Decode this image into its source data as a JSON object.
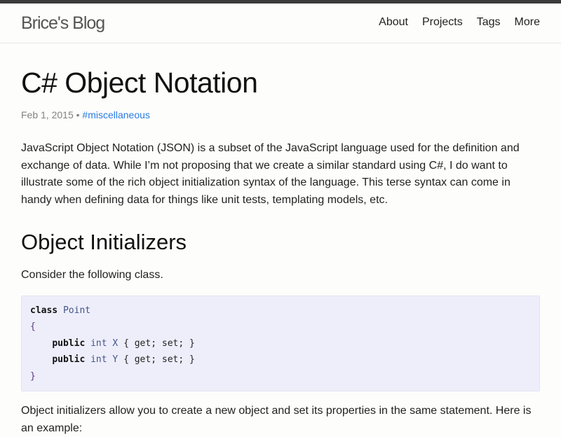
{
  "header": {
    "brand": "Brice's Blog",
    "nav": [
      "About",
      "Projects",
      "Tags",
      "More"
    ]
  },
  "post": {
    "title": "C# Object Notation",
    "date": "Feb 1, 2015",
    "separator": "•",
    "tag": "#miscellaneous",
    "intro": "JavaScript Object Notation (JSON) is a subset of the JavaScript language used for the definition and exchange of data. While I’m not proposing that we create a similar standard using C#, I do want to illustrate some of the rich object initialization syntax of the language. This terse syntax can come in handy when defining data for things like unit tests, templating models, etc.",
    "section_title": "Object Initializers",
    "section_intro": "Consider the following class.",
    "code": {
      "kw_class": "class",
      "class_name": "Point",
      "open": "{",
      "close": "}",
      "lines": [
        {
          "mod": "public",
          "type": "int",
          "name": "X",
          "rest": "{ get; set; }"
        },
        {
          "mod": "public",
          "type": "int",
          "name": "Y",
          "rest": "{ get; set; }"
        }
      ]
    },
    "after_code": "Object initializers allow you to create a new object and set its properties in the same statement. Here is an example:"
  }
}
